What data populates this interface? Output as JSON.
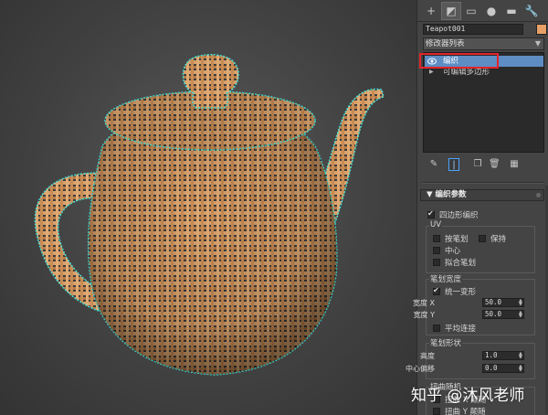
{
  "viewport": {
    "object": "teapot",
    "material_color": "#c8925a",
    "selection_color": "#3fe0d8"
  },
  "toolbar": {
    "icons": [
      {
        "name": "create-icon",
        "glyph": "+"
      },
      {
        "name": "modify-icon",
        "glyph": "◩"
      },
      {
        "name": "hierarchy-icon",
        "glyph": "▭"
      },
      {
        "name": "motion-icon",
        "glyph": "●"
      },
      {
        "name": "display-icon",
        "glyph": "▬"
      },
      {
        "name": "utilities-icon",
        "glyph": "🔧"
      }
    ]
  },
  "object_name": "Teapot001",
  "object_color": "#e6a066",
  "modifier_list": {
    "label": "修改器列表"
  },
  "stack": {
    "items": [
      {
        "label": "编织",
        "selected": true
      },
      {
        "label": "可编辑多边形",
        "selected": false
      }
    ]
  },
  "rollout": {
    "title": "编织参数",
    "quad_weave": "四边形编织",
    "uv_group": "UV",
    "uv_options": [
      "按笔划",
      "保持",
      "中心",
      "拟合笔划"
    ],
    "stroke_width_group": "笔划宽度",
    "uniform": "统一变形",
    "width_x": {
      "label": "宽度 X",
      "value": "50.0"
    },
    "width_y": {
      "label": "宽度 Y",
      "value": "50.0"
    },
    "smooth_join": "平均连接",
    "stroke_shape_group": "笔划形状",
    "height": {
      "label": "高度",
      "value": "1.0"
    },
    "center_offset": {
      "label": "中心偏移",
      "value": "0.0"
    },
    "twist_group": "扭曲随机",
    "twist_x": "扭曲 X 颠随",
    "twist_y": "扭曲 Y 颠随"
  },
  "watermark": "知乎 @沐风老师"
}
